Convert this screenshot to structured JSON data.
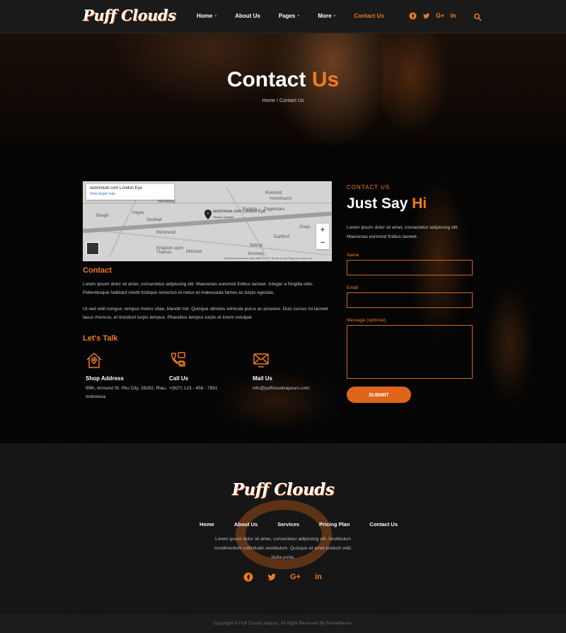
{
  "brand": "Puff Clouds",
  "nav": {
    "items": [
      {
        "label": "Home",
        "caret": true
      },
      {
        "label": "About Us",
        "caret": false
      },
      {
        "label": "Pages",
        "caret": true
      },
      {
        "label": "More",
        "caret": true
      },
      {
        "label": "Contact Us",
        "caret": false,
        "active": true
      }
    ],
    "social": [
      "facebook-icon",
      "twitter-icon",
      "google-plus-icon",
      "linkedin-icon"
    ],
    "search_icon": "search-icon"
  },
  "hero": {
    "title_main": "Contact",
    "title_accent": "Us",
    "breadcrumb": "Home / Contact Us"
  },
  "map": {
    "card_title": "lastminute.com London Eye",
    "card_link": "View larger map",
    "pin_label": "lastminute.com London Eye",
    "pin_sub": "Historic riverside",
    "labels": [
      "Romford",
      "Wembley",
      "Hayes",
      "Slough",
      "Richmond",
      "Barking",
      "Dagenham",
      "Dartford",
      "Sidcup",
      "Mitcham",
      "Kingston upon Thames",
      "Bromley",
      "Grays",
      "Hornchurch",
      "Southall"
    ],
    "zoom_in": "+",
    "zoom_out": "−",
    "attribution": "Keyboard shortcuts   Map data ©2022   Terms of Use   Report a map error"
  },
  "contact": {
    "heading": "Contact",
    "para1": "Lorem ipsum dolor sit amet, consectetur adipiscing elit. Maecenas euismod finibus laoreet. Integer a fringilla odio. Pellentesque habitant morbi tristique senectus et netus et malesuada fames ac turpis egestas.",
    "para2": "Ut sed velit congue, tempus metus vitae, blandit nisl. Quisque ultricies vehicula purus ac posuere. Duis cursus mi laoreet lacus rhoncus, et tincidunt turpis tempus. Phasellus tempus turpis et lorem volutpat.",
    "lets_talk": "Let's Talk",
    "info": [
      {
        "icon": "house-location-icon",
        "title": "Shop Address",
        "text": "99th, Arround St. Pku City, 28292, Riau, Indonesia"
      },
      {
        "icon": "phone-icon",
        "title": "Call Us",
        "text": "+(827) 123 - 456 - 7891"
      },
      {
        "icon": "mail-icon",
        "title": "Mail Us",
        "text": "info@puffcloudvapours.com"
      }
    ]
  },
  "form": {
    "eyebrow": "CONTACT US",
    "title_main": "Just Say",
    "title_accent": "Hi",
    "desc": "Lorem ipsum dolor sit amet, consectetur adipiscing elit. Maecenas euismod finibus laoreet.",
    "name_label": "Name",
    "email_label": "Email",
    "message_label": "Message (optional)",
    "name_value": "",
    "email_value": "",
    "message_value": "",
    "submit_label": "SUBMIT"
  },
  "footer": {
    "brand": "Puff Clouds",
    "nav": [
      "Home",
      "About Us",
      "Services",
      "Pricing Plan",
      "Contact Us"
    ],
    "desc": "Lorem ipsum dolor sit amet, consectetur adipiscing elit. Vestibulum condimentum sollicitudin vestibulum. Quisque sit amet pretium velit. Nulla porta.",
    "social": [
      "facebook-icon",
      "twitter-icon",
      "google-plus-icon",
      "linkedin-icon"
    ],
    "copyright": "Copyright © Puff Clouds Vapour. All Right Reserved By Rometheme."
  },
  "colors": {
    "accent": "#f07a1e",
    "background": "#000000",
    "navbar": "#1a1a1a",
    "footer": "#141414"
  }
}
